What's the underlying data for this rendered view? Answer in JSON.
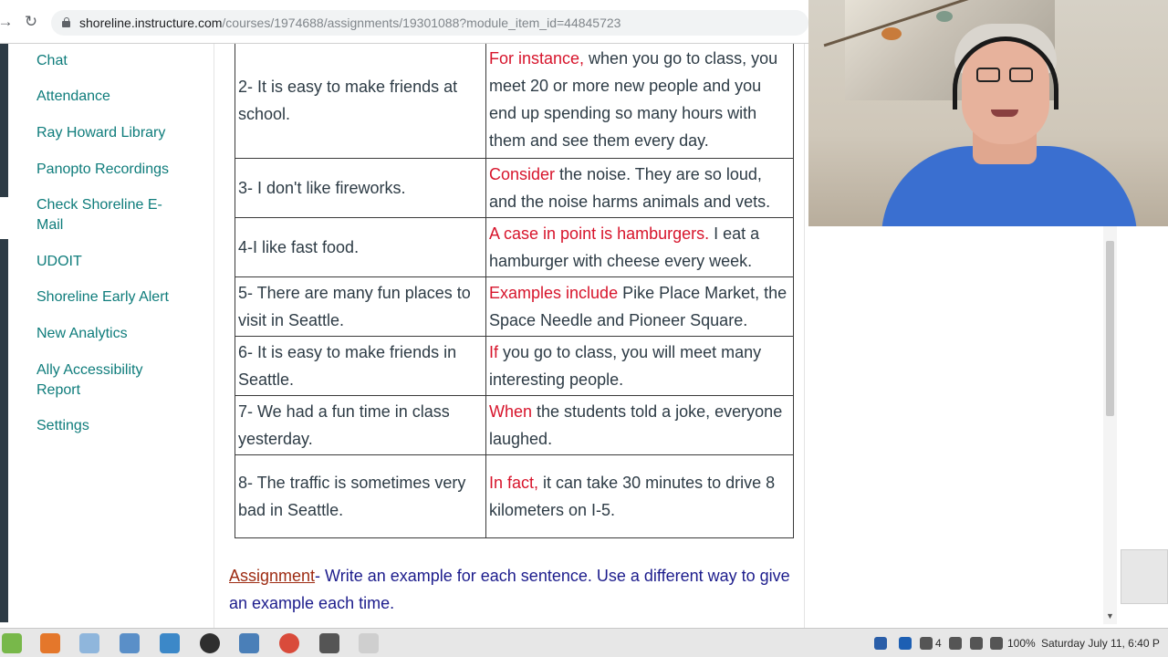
{
  "browser": {
    "url_host": "shoreline.instructure.com",
    "url_path": "/courses/1974688/assignments/19301088?module_item_id=44845723"
  },
  "sidebar": {
    "items": [
      {
        "label": "Chat"
      },
      {
        "label": "Attendance"
      },
      {
        "label": "Ray Howard Library"
      },
      {
        "label": "Panopto Recordings"
      },
      {
        "label": "Check Shoreline E-Mail"
      },
      {
        "label": "UDOIT"
      },
      {
        "label": "Shoreline Early Alert"
      },
      {
        "label": "New Analytics"
      },
      {
        "label": "Ally Accessibility Report"
      },
      {
        "label": "Settings"
      }
    ]
  },
  "table": {
    "rows": [
      {
        "sentence": "2- It is easy to make friends at school.",
        "hl": "For instance,",
        "rest": " when you go to class, you meet 20 or more new people and you end up spending so many hours with them and see them every day."
      },
      {
        "sentence": "3- I don't like fireworks.",
        "hl": "Consider",
        "rest": " the noise. They are so loud, and the noise harms animals and vets."
      },
      {
        "sentence": "4-I like fast food.",
        "hl": "A case in point is hamburgers.",
        "rest": " I eat a hamburger with cheese every week."
      },
      {
        "sentence": "5- There are many fun places to visit in Seattle.",
        "hl": "Examples include",
        "rest": " Pike Place Market, the Space Needle and Pioneer Square."
      },
      {
        "sentence": "6- It is easy to make friends in Seattle.",
        "hl": "If",
        "rest": " you go to class, you will meet many interesting people."
      },
      {
        "sentence": "7- We had a fun time in class yesterday.",
        "hl": "When",
        "rest": " the students told a joke, everyone laughed."
      },
      {
        "sentence": "8- The traffic is sometimes very bad in Seattle.",
        "hl": "In fact,",
        "rest": " it can take 30 minutes to drive 8 kilometers on I-5."
      }
    ]
  },
  "assignment": {
    "label": "Assignment",
    "text": "- Write an example for each sentence.  Use a different way to give an example each time."
  },
  "taskbar": {
    "volume_percent": "4",
    "battery": "100%",
    "datetime": "Saturday July 11, 6:40 P"
  },
  "colors": {
    "link": "#0e7c7b",
    "highlight_red": "#d7152c",
    "assignment_blue": "#1c1c8c",
    "assignment_label": "#9d2b12"
  }
}
